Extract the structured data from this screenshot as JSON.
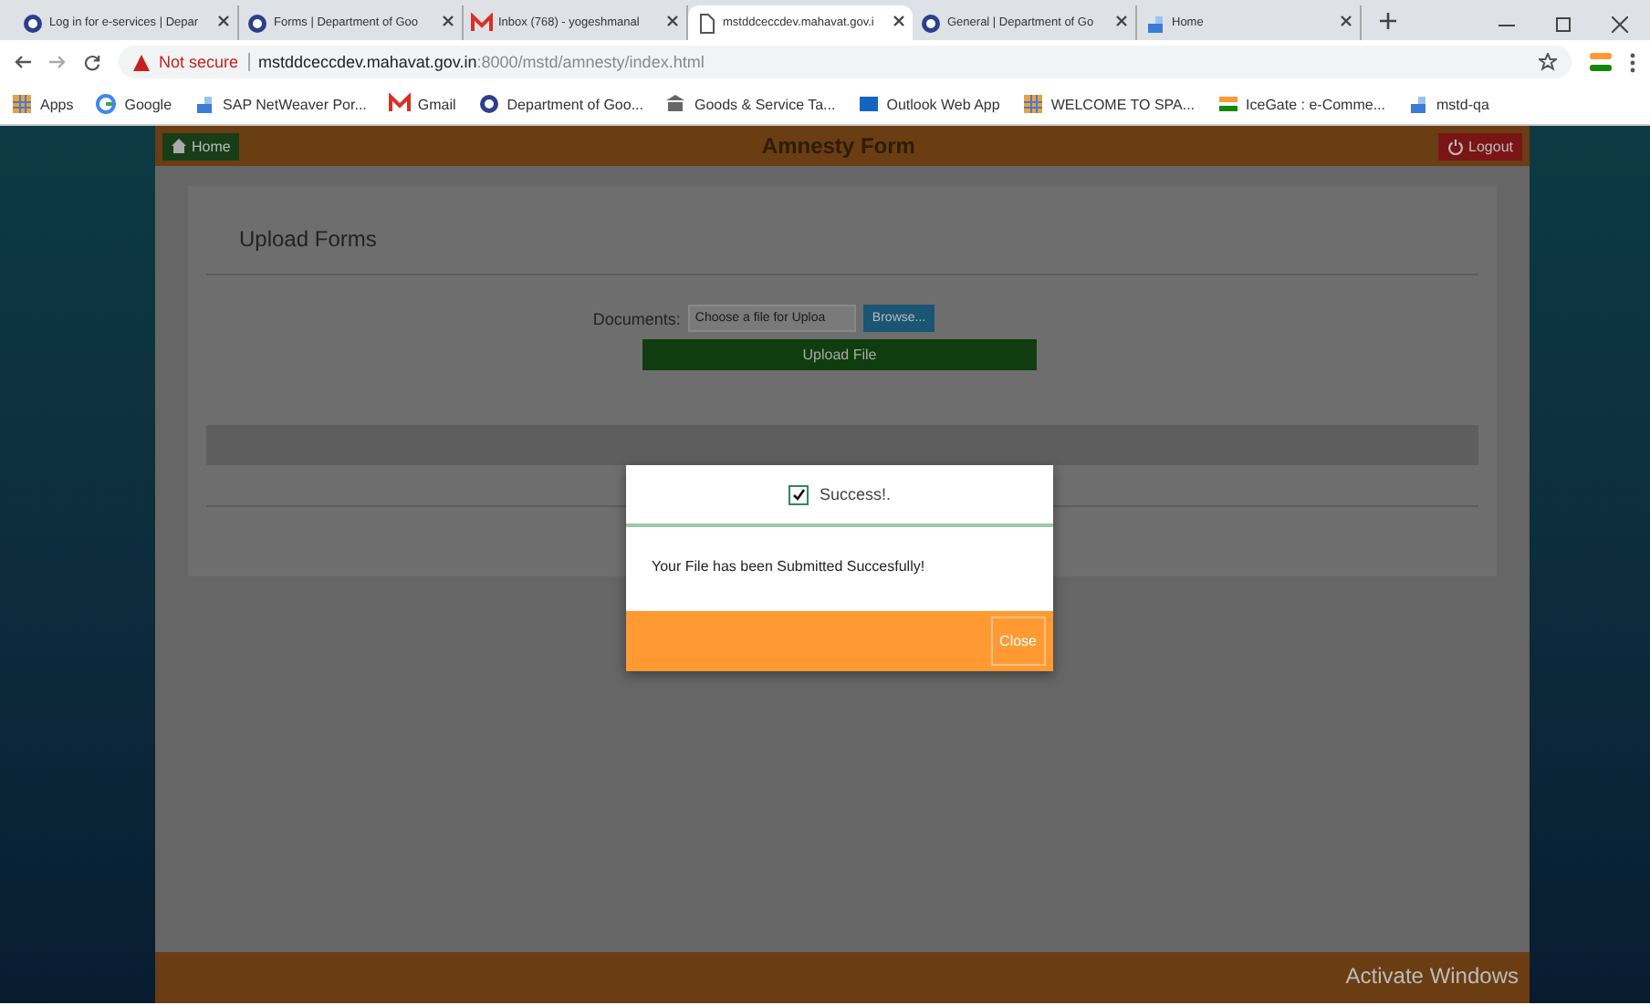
{
  "browser": {
    "tabs": [
      {
        "title": "Log in for e-services | Depar",
        "selected": false
      },
      {
        "title": "Forms | Department of Goo",
        "selected": false
      },
      {
        "title": "Inbox (768) - yogeshmanal",
        "selected": false
      },
      {
        "title": "mstddceccdev.mahavat.gov.i",
        "selected": true
      },
      {
        "title": "General | Department of Go",
        "selected": false
      },
      {
        "title": "Home",
        "selected": false
      }
    ],
    "security": "Not secure",
    "url_host": "mstddceccdev.mahavat.gov.in",
    "url_path": ":8000/mstd/amnesty/index.html",
    "bookmarks": [
      {
        "label": "Apps"
      },
      {
        "label": "Google"
      },
      {
        "label": "SAP NetWeaver Por..."
      },
      {
        "label": "Gmail"
      },
      {
        "label": "Department of Goo..."
      },
      {
        "label": "Goods & Service Ta..."
      },
      {
        "label": "Outlook Web App"
      },
      {
        "label": "WELCOME TO SPA..."
      },
      {
        "label": "IceGate : e-Comme..."
      },
      {
        "label": "mstd-qa"
      }
    ]
  },
  "header": {
    "home": "Home",
    "title": "Amnesty Form",
    "logout": "Logout"
  },
  "upload": {
    "heading": "Upload Forms",
    "label": "Documents:",
    "placeholder": "Choose a file for Uploa",
    "browse": "Browse...",
    "submit": "Upload File"
  },
  "dialog": {
    "title": "Success!.",
    "checked": true,
    "message": "Your File has been Submitted Succesfully!",
    "close": "Close"
  },
  "os_notice": "Activate Windows"
}
